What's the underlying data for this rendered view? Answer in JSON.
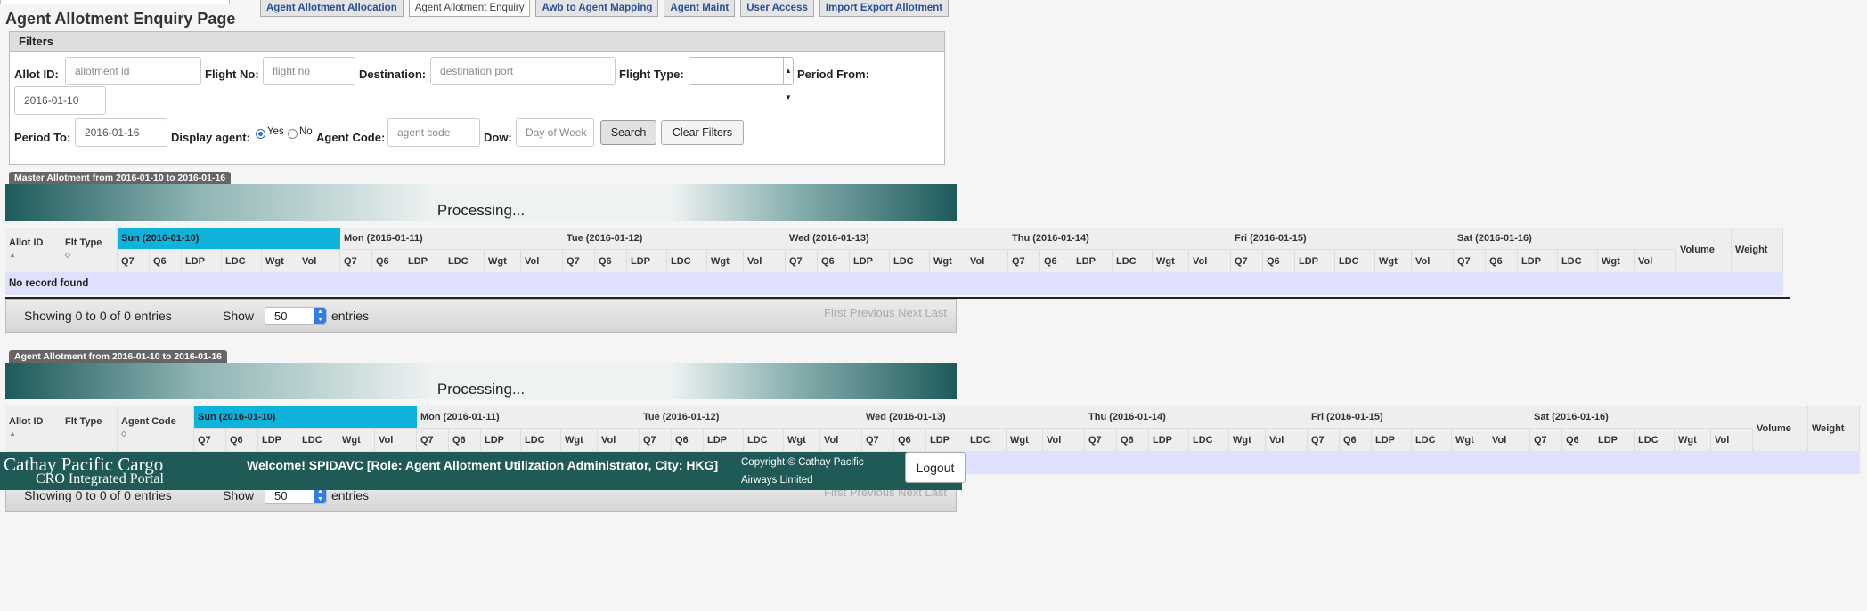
{
  "tabs": [
    "Agent Allotment Allocation",
    "Agent Allotment Enquiry",
    "Awb to Agent Mapping",
    "Agent Maint",
    "User Access",
    "Import Export Allotment"
  ],
  "page_title": "Agent Allotment Enquiry Page",
  "filters": {
    "heading": "Filters",
    "allot_id_label": "Allot ID:",
    "allot_id_placeholder": "allotment id",
    "flight_no_label": "Flight No:",
    "flight_no_placeholder": "flight no",
    "destination_label": "Destination:",
    "destination_placeholder": "destination port",
    "flight_type_label": "Flight Type:",
    "flight_type_value": "",
    "period_from_label": "Period From:",
    "period_from_value": "2016-01-10",
    "period_to_label": "Period To:",
    "period_to_value": "2016-01-16",
    "display_agent_label": "Display agent:",
    "yes_label": "Yes",
    "no_label": "No",
    "display_agent_selected": "Yes",
    "agent_code_label": "Agent Code:",
    "agent_code_placeholder": "agent code",
    "dow_label": "Dow:",
    "dow_placeholder": "Day of Week",
    "search_button": "Search",
    "clear_button": "Clear Filters"
  },
  "processing_text": "Processing...",
  "days": [
    "Sun (2016-01-10)",
    "Mon (2016-01-11)",
    "Tue (2016-01-12)",
    "Wed (2016-01-13)",
    "Thu (2016-01-14)",
    "Fri (2016-01-15)",
    "Sat (2016-01-16)"
  ],
  "sub_columns": [
    "Q7",
    "Q6",
    "LDP",
    "LDC",
    "Wgt",
    "Vol"
  ],
  "master": {
    "label": "Master Allotment from 2016-01-10 to 2016-01-16",
    "col_allot_id": "Allot ID",
    "col_flt_type": "Flt Type",
    "col_volume": "Volume",
    "col_weight": "Weight",
    "no_record": "No record found",
    "showing": "Showing 0 to 0 of 0 entries",
    "show": "Show",
    "page_size": "50",
    "entries": "entries",
    "pagination": "First Previous Next Last"
  },
  "agent": {
    "label": "Agent Allotment from 2016-01-10 to 2016-01-16",
    "col_allot_id": "Allot ID",
    "col_flt_type": "Flt Type",
    "col_agent_code": "Agent Code",
    "col_volume": "Volume",
    "col_weight": "Weight",
    "showing": "Showing 0 to 0 of 0 entries",
    "show": "Show",
    "page_size": "50",
    "entries": "entries",
    "pagination": "First Previous Next Last"
  },
  "footer": {
    "brand_line1": "Cathay Pacific Cargo",
    "brand_line2": "CRO Integrated Portal",
    "welcome": "Welcome! SPIDAVC [Role: Agent Allotment Utilization Administrator, City: HKG]",
    "copyright": "Copyright © Cathay Pacific Airways Limited",
    "logout": "Logout"
  },
  "colors": {
    "highlight_day": "#0fb2d8",
    "banner": "#1f5a57",
    "no_record_row": "#dfe0fb"
  }
}
